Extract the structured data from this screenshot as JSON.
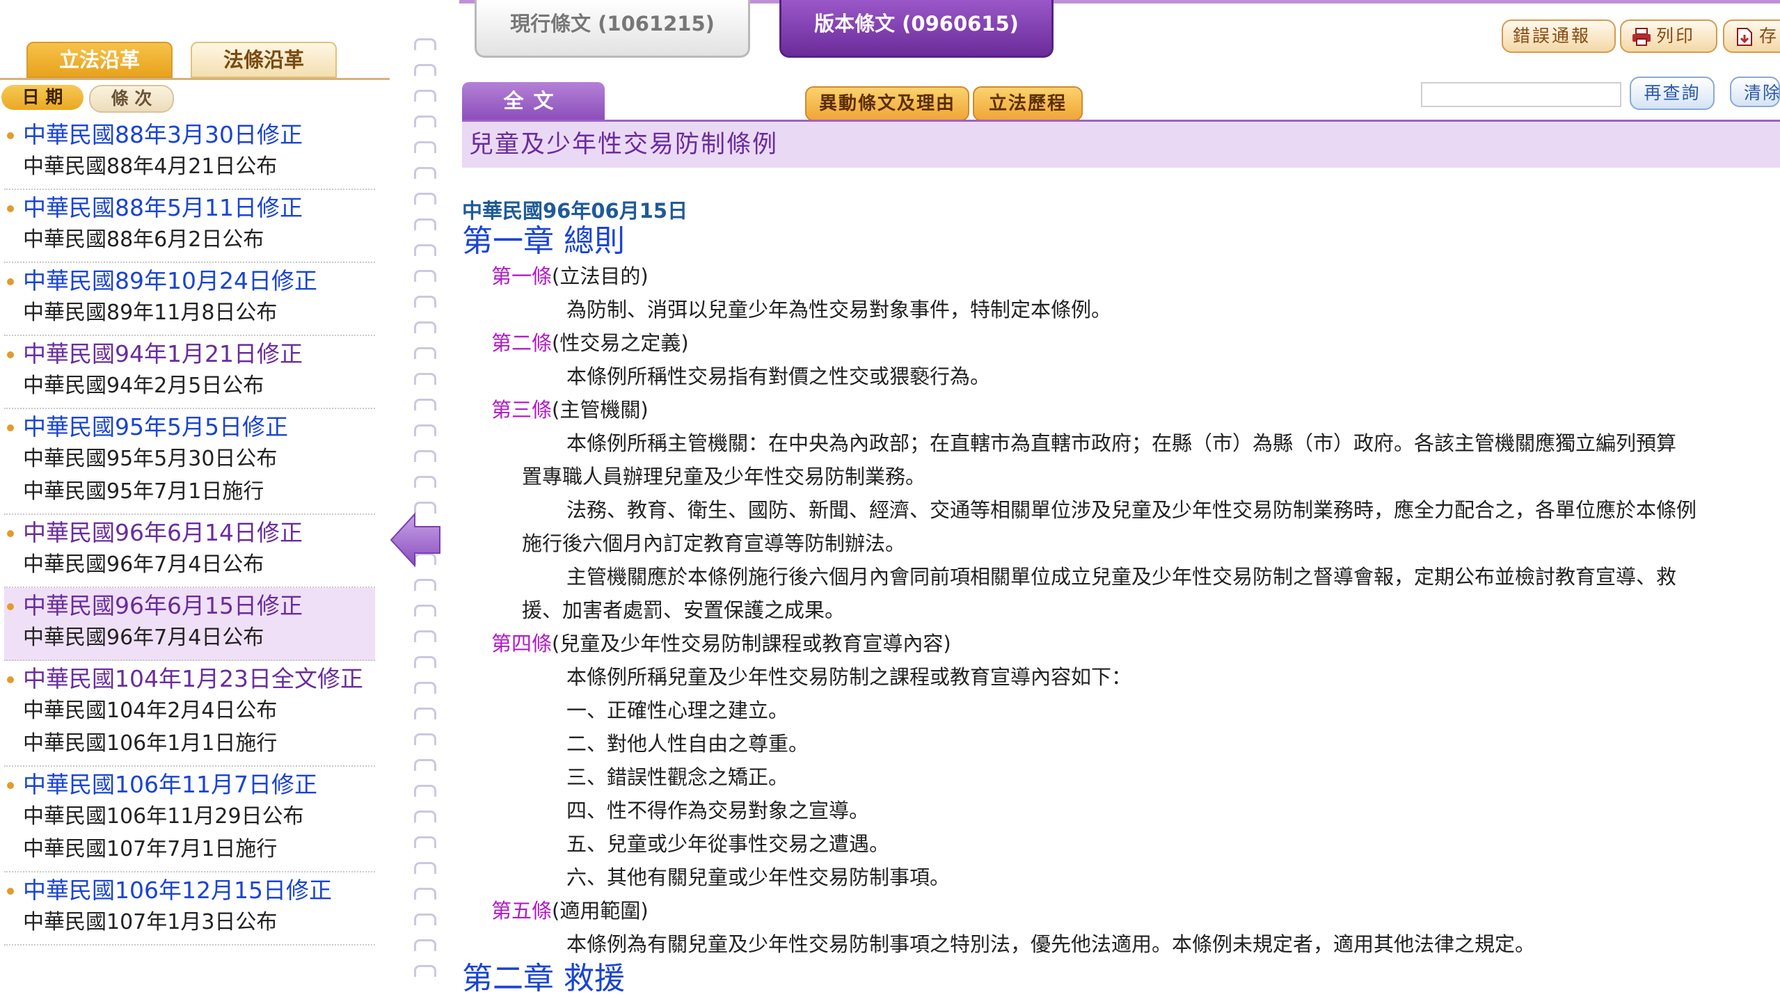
{
  "left": {
    "tabs": [
      "立法沿革",
      "法條沿革"
    ],
    "sort_pills": [
      "日 期",
      "條 次"
    ],
    "versions": [
      {
        "amend": "中華民國88年3月30日修正",
        "sub": [
          "中華民國88年4月21日公布"
        ],
        "selected": false,
        "visited": false
      },
      {
        "amend": "中華民國88年5月11日修正",
        "sub": [
          "中華民國88年6月2日公布"
        ],
        "selected": false,
        "visited": false
      },
      {
        "amend": "中華民國89年10月24日修正",
        "sub": [
          "中華民國89年11月8日公布"
        ],
        "selected": false,
        "visited": false
      },
      {
        "amend": "中華民國94年1月21日修正",
        "sub": [
          "中華民國94年2月5日公布"
        ],
        "selected": false,
        "visited": true
      },
      {
        "amend": "中華民國95年5月5日修正",
        "sub": [
          "中華民國95年5月30日公布",
          "中華民國95年7月1日施行"
        ],
        "selected": false,
        "visited": false
      },
      {
        "amend": "中華民國96年6月14日修正",
        "sub": [
          "中華民國96年7月4日公布"
        ],
        "selected": false,
        "visited": true
      },
      {
        "amend": "中華民國96年6月15日修正",
        "sub": [
          "中華民國96年7月4日公布"
        ],
        "selected": true,
        "visited": true
      },
      {
        "amend": "中華民國104年1月23日全文修正",
        "sub": [
          "中華民國104年2月4日公布",
          "中華民國106年1月1日施行"
        ],
        "selected": false,
        "visited": true
      },
      {
        "amend": "中華民國106年11月7日修正",
        "sub": [
          "中華民國106年11月29日公布",
          "中華民國107年7月1日施行"
        ],
        "selected": false,
        "visited": false
      },
      {
        "amend": "中華民國106年12月15日修正",
        "sub": [
          "中華民國107年1月3日公布"
        ],
        "selected": false,
        "visited": false
      }
    ]
  },
  "top": {
    "current_tab": "現行條文 (1061215)",
    "version_tab": "版本條文 (0960615)",
    "btn_report": "錯誤通報",
    "btn_print": "列印",
    "btn_save": "存",
    "btn_fulltext": "全文",
    "btn_diff": "異動條文及理由",
    "btn_process": "立法歷程",
    "btn_requery": "再查詢",
    "btn_clear": "清除",
    "search_value": ""
  },
  "law": {
    "title": "兒童及少年性交易防制條例",
    "date": "中華民國96年06月15日",
    "blocks": [
      {
        "type": "chapter",
        "text": "第一章 總則"
      },
      {
        "type": "article",
        "no": "第一條",
        "cap": "(立法目的)"
      },
      {
        "type": "first",
        "text": "為防制、消弭以兒童少年為性交易對象事件，特制定本條例。"
      },
      {
        "type": "article",
        "no": "第二條",
        "cap": "(性交易之定義)"
      },
      {
        "type": "first",
        "text": "本條例所稱性交易指有對價之性交或猥褻行為。"
      },
      {
        "type": "article",
        "no": "第三條",
        "cap": "(主管機關)"
      },
      {
        "type": "first",
        "text": "本條例所稱主管機關：在中央為內政部；在直轄市為直轄市政府；在縣（市）為縣（市）政府。各該主管機關應獨立編列預算"
      },
      {
        "type": "cont",
        "text": "置專職人員辦理兒童及少年性交易防制業務。"
      },
      {
        "type": "first",
        "text": "法務、教育、衛生、國防、新聞、經濟、交通等相關單位涉及兒童及少年性交易防制業務時，應全力配合之，各單位應於本條例"
      },
      {
        "type": "cont",
        "text": "施行後六個月內訂定教育宣導等防制辦法。"
      },
      {
        "type": "first",
        "text": "主管機關應於本條例施行後六個月內會同前項相關單位成立兒童及少年性交易防制之督導會報，定期公布並檢討教育宣導、救"
      },
      {
        "type": "cont",
        "text": "援、加害者處罰、安置保護之成果。"
      },
      {
        "type": "article",
        "no": "第四條",
        "cap": "(兒童及少年性交易防制課程或教育宣導內容)"
      },
      {
        "type": "first",
        "text": "本條例所稱兒童及少年性交易防制之課程或教育宣導內容如下："
      },
      {
        "type": "item",
        "text": "一、正確性心理之建立。"
      },
      {
        "type": "item",
        "text": "二、對他人性自由之尊重。"
      },
      {
        "type": "item",
        "text": "三、錯誤性觀念之矯正。"
      },
      {
        "type": "item",
        "text": "四、性不得作為交易對象之宣導。"
      },
      {
        "type": "item",
        "text": "五、兒童或少年從事性交易之遭遇。"
      },
      {
        "type": "item",
        "text": "六、其他有關兒童或少年性交易防制事項。"
      },
      {
        "type": "article",
        "no": "第五條",
        "cap": "(適用範圍)"
      },
      {
        "type": "first",
        "text": "本條例為有關兒童及少年性交易防制事項之特別法，優先他法適用。本條例未規定者，適用其他法律之規定。"
      },
      {
        "type": "chapter",
        "text": "第二章 救援"
      }
    ]
  },
  "colors": {
    "link_blue": "#1a44d4",
    "visited_purple": "#6a2c9e",
    "article_magenta": "#b21bc9",
    "accent_purple": "#7b3aa8",
    "accent_orange": "#f0a636"
  }
}
